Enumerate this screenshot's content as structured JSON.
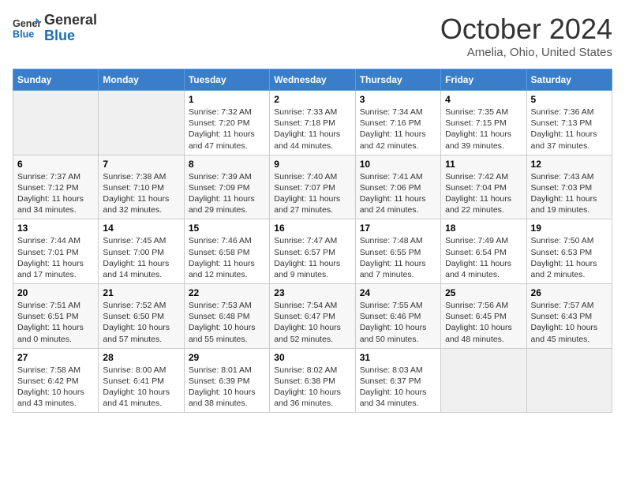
{
  "header": {
    "logo_line1": "General",
    "logo_line2": "Blue",
    "title": "October 2024",
    "subtitle": "Amelia, Ohio, United States"
  },
  "days_of_week": [
    "Sunday",
    "Monday",
    "Tuesday",
    "Wednesday",
    "Thursday",
    "Friday",
    "Saturday"
  ],
  "weeks": [
    [
      {
        "day": "",
        "info": ""
      },
      {
        "day": "",
        "info": ""
      },
      {
        "day": "1",
        "info": "Sunrise: 7:32 AM\nSunset: 7:20 PM\nDaylight: 11 hours and 47 minutes."
      },
      {
        "day": "2",
        "info": "Sunrise: 7:33 AM\nSunset: 7:18 PM\nDaylight: 11 hours and 44 minutes."
      },
      {
        "day": "3",
        "info": "Sunrise: 7:34 AM\nSunset: 7:16 PM\nDaylight: 11 hours and 42 minutes."
      },
      {
        "day": "4",
        "info": "Sunrise: 7:35 AM\nSunset: 7:15 PM\nDaylight: 11 hours and 39 minutes."
      },
      {
        "day": "5",
        "info": "Sunrise: 7:36 AM\nSunset: 7:13 PM\nDaylight: 11 hours and 37 minutes."
      }
    ],
    [
      {
        "day": "6",
        "info": "Sunrise: 7:37 AM\nSunset: 7:12 PM\nDaylight: 11 hours and 34 minutes."
      },
      {
        "day": "7",
        "info": "Sunrise: 7:38 AM\nSunset: 7:10 PM\nDaylight: 11 hours and 32 minutes."
      },
      {
        "day": "8",
        "info": "Sunrise: 7:39 AM\nSunset: 7:09 PM\nDaylight: 11 hours and 29 minutes."
      },
      {
        "day": "9",
        "info": "Sunrise: 7:40 AM\nSunset: 7:07 PM\nDaylight: 11 hours and 27 minutes."
      },
      {
        "day": "10",
        "info": "Sunrise: 7:41 AM\nSunset: 7:06 PM\nDaylight: 11 hours and 24 minutes."
      },
      {
        "day": "11",
        "info": "Sunrise: 7:42 AM\nSunset: 7:04 PM\nDaylight: 11 hours and 22 minutes."
      },
      {
        "day": "12",
        "info": "Sunrise: 7:43 AM\nSunset: 7:03 PM\nDaylight: 11 hours and 19 minutes."
      }
    ],
    [
      {
        "day": "13",
        "info": "Sunrise: 7:44 AM\nSunset: 7:01 PM\nDaylight: 11 hours and 17 minutes."
      },
      {
        "day": "14",
        "info": "Sunrise: 7:45 AM\nSunset: 7:00 PM\nDaylight: 11 hours and 14 minutes."
      },
      {
        "day": "15",
        "info": "Sunrise: 7:46 AM\nSunset: 6:58 PM\nDaylight: 11 hours and 12 minutes."
      },
      {
        "day": "16",
        "info": "Sunrise: 7:47 AM\nSunset: 6:57 PM\nDaylight: 11 hours and 9 minutes."
      },
      {
        "day": "17",
        "info": "Sunrise: 7:48 AM\nSunset: 6:55 PM\nDaylight: 11 hours and 7 minutes."
      },
      {
        "day": "18",
        "info": "Sunrise: 7:49 AM\nSunset: 6:54 PM\nDaylight: 11 hours and 4 minutes."
      },
      {
        "day": "19",
        "info": "Sunrise: 7:50 AM\nSunset: 6:53 PM\nDaylight: 11 hours and 2 minutes."
      }
    ],
    [
      {
        "day": "20",
        "info": "Sunrise: 7:51 AM\nSunset: 6:51 PM\nDaylight: 11 hours and 0 minutes."
      },
      {
        "day": "21",
        "info": "Sunrise: 7:52 AM\nSunset: 6:50 PM\nDaylight: 10 hours and 57 minutes."
      },
      {
        "day": "22",
        "info": "Sunrise: 7:53 AM\nSunset: 6:48 PM\nDaylight: 10 hours and 55 minutes."
      },
      {
        "day": "23",
        "info": "Sunrise: 7:54 AM\nSunset: 6:47 PM\nDaylight: 10 hours and 52 minutes."
      },
      {
        "day": "24",
        "info": "Sunrise: 7:55 AM\nSunset: 6:46 PM\nDaylight: 10 hours and 50 minutes."
      },
      {
        "day": "25",
        "info": "Sunrise: 7:56 AM\nSunset: 6:45 PM\nDaylight: 10 hours and 48 minutes."
      },
      {
        "day": "26",
        "info": "Sunrise: 7:57 AM\nSunset: 6:43 PM\nDaylight: 10 hours and 45 minutes."
      }
    ],
    [
      {
        "day": "27",
        "info": "Sunrise: 7:58 AM\nSunset: 6:42 PM\nDaylight: 10 hours and 43 minutes."
      },
      {
        "day": "28",
        "info": "Sunrise: 8:00 AM\nSunset: 6:41 PM\nDaylight: 10 hours and 41 minutes."
      },
      {
        "day": "29",
        "info": "Sunrise: 8:01 AM\nSunset: 6:39 PM\nDaylight: 10 hours and 38 minutes."
      },
      {
        "day": "30",
        "info": "Sunrise: 8:02 AM\nSunset: 6:38 PM\nDaylight: 10 hours and 36 minutes."
      },
      {
        "day": "31",
        "info": "Sunrise: 8:03 AM\nSunset: 6:37 PM\nDaylight: 10 hours and 34 minutes."
      },
      {
        "day": "",
        "info": ""
      },
      {
        "day": "",
        "info": ""
      }
    ]
  ]
}
